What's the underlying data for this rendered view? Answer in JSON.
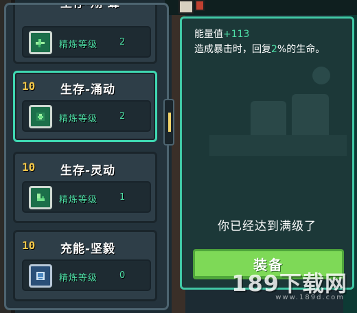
{
  "items": [
    {
      "level": "",
      "name": "生存-翔 蜂",
      "refine_label": "精炼等级",
      "refine_level": "2",
      "icon": "leaf-icon"
    },
    {
      "level": "10",
      "name": "生存-涌动",
      "refine_label": "精炼等级",
      "refine_level": "2",
      "icon": "sprout-icon"
    },
    {
      "level": "10",
      "name": "生存-灵动",
      "refine_label": "精炼等级",
      "refine_level": "1",
      "icon": "boot-icon"
    },
    {
      "level": "10",
      "name": "充能-坚毅",
      "refine_label": "精炼等级",
      "refine_level": "0",
      "icon": "shield-icon"
    }
  ],
  "detail": {
    "stat_label": "能量值",
    "stat_value": "+113",
    "desc_before": "造成暴击时，回复",
    "desc_value": "2",
    "desc_after": "%的生命。",
    "max_level_text": "你已经达到满级了",
    "equip_label": "装备"
  },
  "watermark": {
    "text": "189下载网",
    "url": "www.189d.com"
  },
  "colors": {
    "accent": "#3fd8b2",
    "level_gold": "#f5c84a",
    "refine_green": "#4fe0a8",
    "button_green": "#7ed957"
  }
}
